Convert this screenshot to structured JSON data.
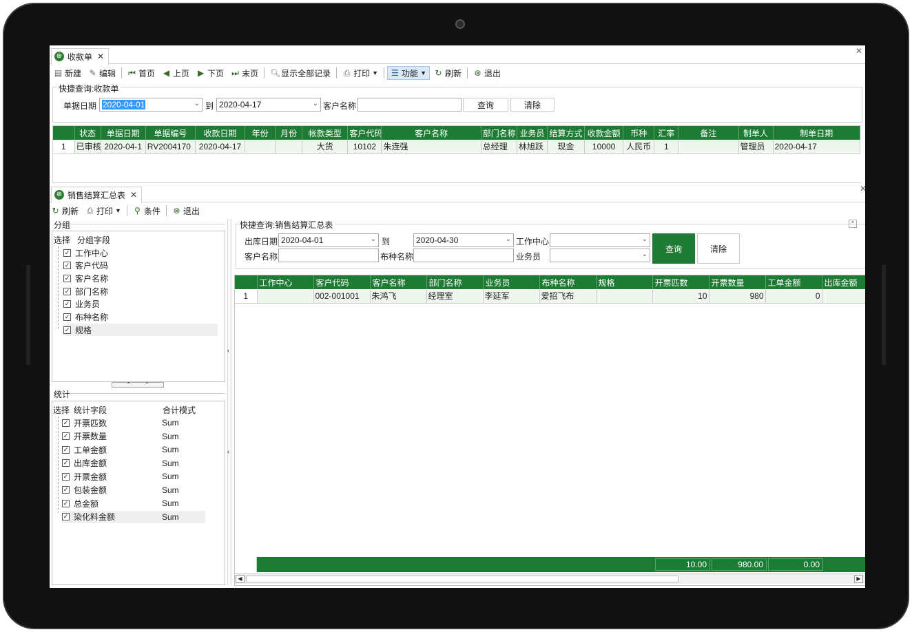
{
  "top_window": {
    "tab_title": "收款单",
    "toolbar": [
      "新建",
      "编辑",
      "首页",
      "上页",
      "下页",
      "末页",
      "显示全部记录",
      "打印",
      "功能",
      "刷新",
      "退出"
    ],
    "quick_query_title": "快捷查询:收款单",
    "date_label": "单据日期",
    "date_from": "2020-04-01",
    "to_label": "到",
    "date_to": "2020-04-17",
    "customer_label": "客户名称",
    "customer_value": "",
    "query_button": "查询",
    "clear_button": "清除",
    "grid": {
      "headers": [
        "",
        "状态",
        "单据日期",
        "单据编号",
        "收款日期",
        "年份",
        "月份",
        "帐款类型",
        "客户代码",
        "客户名称",
        "部门名称",
        "业务员",
        "结算方式",
        "收款金额",
        "币种",
        "汇率",
        "备注",
        "制单人",
        "制单日期"
      ],
      "rows": [
        [
          "1",
          "已审核",
          "2020-04-1",
          "RV2004170",
          "2020-04-17",
          "",
          "",
          "大货",
          "10102",
          "朱连强",
          "总经理",
          "林旭跃",
          "现金",
          "10000",
          "人民币",
          "1",
          "",
          "管理员",
          "2020-04-17"
        ]
      ]
    }
  },
  "bottom_window": {
    "tab_title": "销售结算汇总表",
    "toolbar": [
      "刷新",
      "打印",
      "条件",
      "退出"
    ],
    "group_title": "分组",
    "group_headers": [
      "选择",
      "分组字段"
    ],
    "group_fields": [
      "工作中心",
      "客户代码",
      "客户名称",
      "部门名称",
      "业务员",
      "布种名称",
      "规格"
    ],
    "stat_title": "统计",
    "stat_headers": [
      "选择",
      "统计字段",
      "合计模式"
    ],
    "stat_fields": [
      {
        "name": "开票匹数",
        "mode": "Sum"
      },
      {
        "name": "开票数量",
        "mode": "Sum"
      },
      {
        "name": "工单金额",
        "mode": "Sum"
      },
      {
        "name": "出库金额",
        "mode": "Sum"
      },
      {
        "name": "开票金额",
        "mode": "Sum"
      },
      {
        "name": "包装金额",
        "mode": "Sum"
      },
      {
        "name": "总金额",
        "mode": "Sum"
      },
      {
        "name": "染化料金额",
        "mode": "Sum"
      }
    ],
    "quick_query_title": "快捷查询:销售结算汇总表",
    "out_date_label": "出库日期",
    "out_date_from": "2020-04-01",
    "to_label": "到",
    "out_date_to": "2020-04-30",
    "work_center_label": "工作中心",
    "customer_label": "客户名称",
    "fabric_label": "布种名称",
    "salesman_label": "业务员",
    "query_button": "查询",
    "clear_button": "清除",
    "grid": {
      "headers": [
        "",
        "工作中心",
        "客户代码",
        "客户名称",
        "部门名称",
        "业务员",
        "布种名称",
        "规格",
        "开票匹数",
        "开票数量",
        "工单金额",
        "出库金额"
      ],
      "rows": [
        [
          "1",
          "",
          "002-001001",
          "朱鸿飞",
          "经理室",
          "李延军",
          "爱招飞布",
          "",
          "10",
          "980",
          "0",
          ""
        ]
      ],
      "totals": [
        "10.00",
        "980.00",
        "0.00"
      ]
    }
  }
}
